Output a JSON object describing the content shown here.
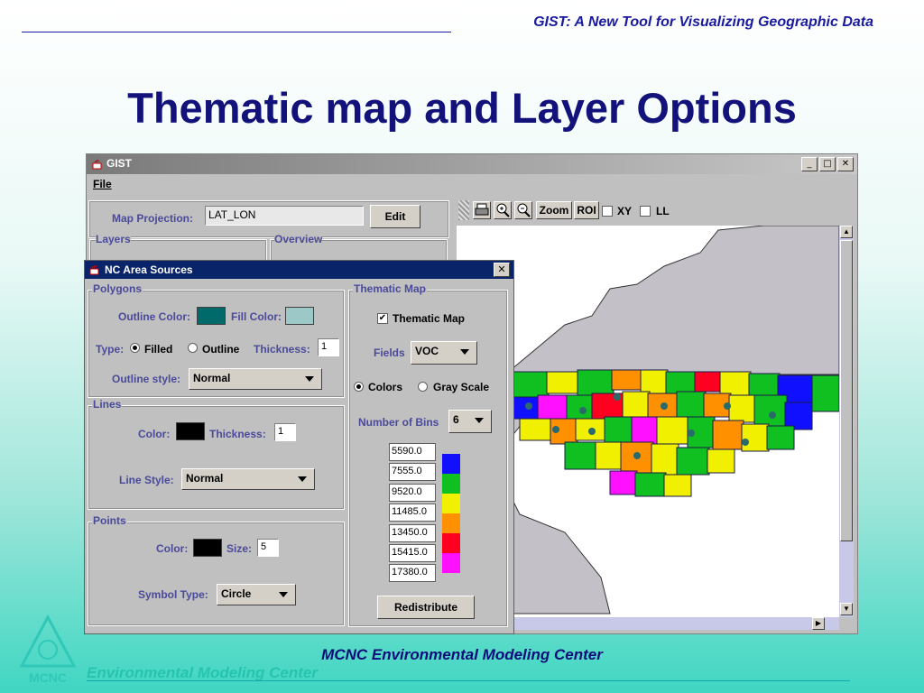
{
  "slide": {
    "header": "GIST: A New Tool for Visualizing Geographic Data",
    "title": "Thematic map and Layer Options",
    "footer": "MCNC Environmental Modeling Center",
    "footer_watermark": "Environmental Modeling Center",
    "logo_text": "MCNC"
  },
  "gist_window": {
    "title": "GIST",
    "menu_file": "File",
    "map_projection_label": "Map Projection:",
    "map_projection_value": "LAT_LON",
    "edit_button": "Edit",
    "layers_group": "Layers",
    "overview_group": "Overview",
    "toolbar": {
      "zoom": "Zoom",
      "roi": "ROI",
      "xy": "XY",
      "ll": "LL",
      "icons": [
        "printer-icon",
        "zoom-in-icon",
        "zoom-out-icon"
      ]
    }
  },
  "dialog": {
    "title": "NC Area Sources",
    "polygons": {
      "title": "Polygons",
      "outline_color_label": "Outline Color:",
      "fill_color_label": "Fill Color:",
      "outline_color": "#006a6a",
      "fill_color": "#9cc8c8",
      "type_label": "Type:",
      "filled": "Filled",
      "outline": "Outline",
      "thickness_label": "Thickness:",
      "thickness": "1",
      "outline_style_label": "Outline style:",
      "outline_style": "Normal"
    },
    "lines": {
      "title": "Lines",
      "color_label": "Color:",
      "color": "#000000",
      "thickness_label": "Thickness:",
      "thickness": "1",
      "line_style_label": "Line Style:",
      "line_style": "Normal"
    },
    "points": {
      "title": "Points",
      "color_label": "Color:",
      "color": "#000000",
      "size_label": "Size:",
      "size": "5",
      "symbol_type_label": "Symbol Type:",
      "symbol_type": "Circle"
    },
    "thematic": {
      "title": "Thematic Map",
      "checkbox_label": "Thematic Map",
      "checked": true,
      "fields_label": "Fields",
      "fields_value": "VOC",
      "colors_label": "Colors",
      "grayscale_label": "Gray Scale",
      "bins_label": "Number of Bins",
      "bins_value": "6",
      "bins": [
        {
          "value": "5590.0",
          "color": "#1010ff"
        },
        {
          "value": "7555.0",
          "color": "#10c020"
        },
        {
          "value": "9520.0",
          "color": "#f0f000"
        },
        {
          "value": "11485.0",
          "color": "#ff9000"
        },
        {
          "value": "13450.0",
          "color": "#ff0020"
        },
        {
          "value": "15415.0",
          "color": "#ff10ff"
        },
        {
          "value": "17380.0",
          "color": ""
        }
      ],
      "redistribute_button": "Redistribute"
    }
  }
}
